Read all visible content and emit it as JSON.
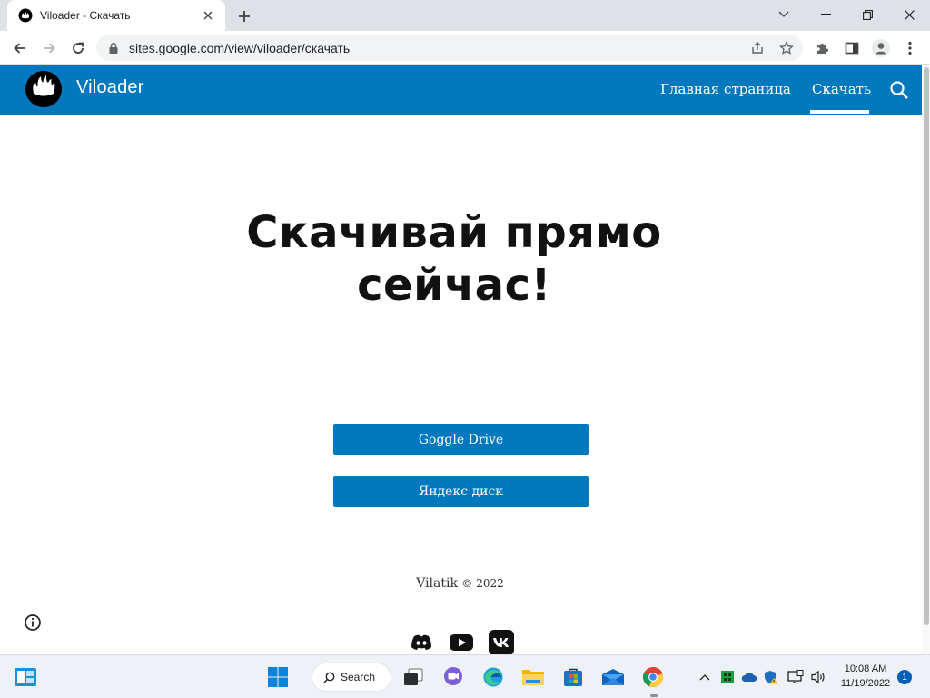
{
  "browser": {
    "tab_title": "Viloader - Скачать",
    "new_tab_icon": "plus-icon",
    "url_host": "sites.google.com",
    "url_path": "/view/viloader/скачать"
  },
  "site": {
    "name": "Viloader",
    "nav": [
      {
        "label": "Главная страница",
        "active": false
      },
      {
        "label": "Скачать",
        "active": true
      }
    ],
    "hero_line1": "Скачивай прямо",
    "hero_line2": "сейчас!",
    "buttons": [
      {
        "label": "Goggle Drive"
      },
      {
        "label": "Яндекс диск"
      }
    ],
    "footer_author": "Vilatik",
    "footer_copy": "© 2022",
    "social": [
      "discord-icon",
      "youtube-icon",
      "vk-icon"
    ],
    "colors": {
      "brand": "#0078be",
      "text": "#111111"
    }
  },
  "taskbar": {
    "search_label": "Search",
    "time": "10:08 AM",
    "date": "11/19/2022",
    "notification_count": "1"
  }
}
